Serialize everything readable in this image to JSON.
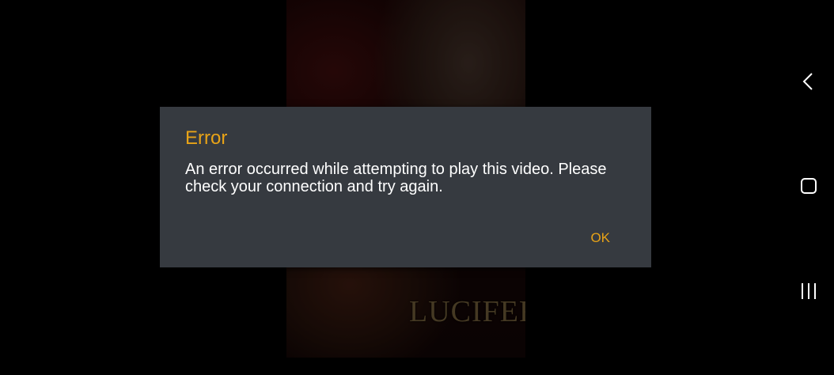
{
  "background": {
    "poster_title": "LUCIFER"
  },
  "dialog": {
    "title": "Error",
    "message": "An error occurred while attempting to play this video. Please check your connection and try again.",
    "ok_label": "OK"
  },
  "navigation": {
    "back_icon": "chevron-left-icon",
    "home_icon": "rounded-square-icon",
    "recents_icon": "three-bars-icon"
  },
  "colors": {
    "accent": "#e8a317",
    "dialog_background": "#363a40",
    "text": "#ffffff",
    "background": "#000000"
  }
}
